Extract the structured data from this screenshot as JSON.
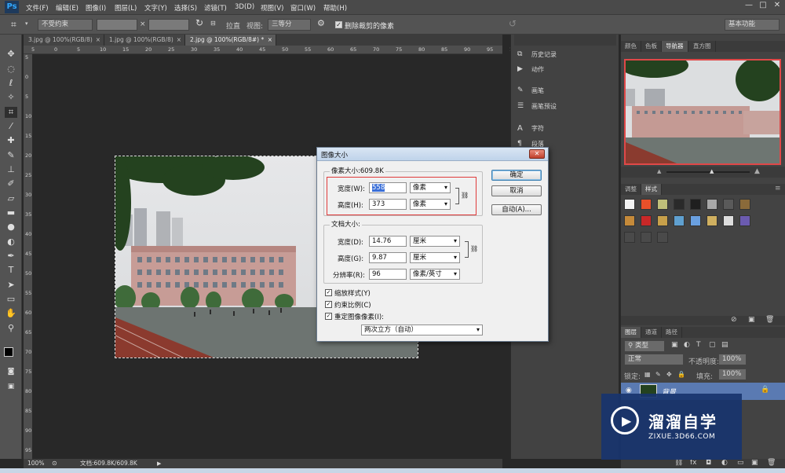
{
  "app": {
    "logo": "Ps"
  },
  "menu": [
    "文件(F)",
    "编辑(E)",
    "图像(I)",
    "图层(L)",
    "文字(Y)",
    "选择(S)",
    "滤镜(T)",
    "3D(D)",
    "视图(V)",
    "窗口(W)",
    "帮助(H)"
  ],
  "window_controls": {
    "minimize": "—",
    "maximize": "□",
    "close": "✕"
  },
  "options": {
    "ratio_select": "不受约束",
    "swap_symbol": "×",
    "straighten_label": "拉直",
    "view_label": "视图:",
    "view_select": "三等分",
    "delete_crop_label": "删除裁剪的像素",
    "delete_crop_checked": true,
    "workspace": "基本功能"
  },
  "doc_tabs": [
    {
      "label": "3.jpg @ 100%(RGB/8)",
      "close": "×"
    },
    {
      "label": "1.jpg @ 100%(RGB/8)",
      "close": "×"
    },
    {
      "label": "2.jpg @ 100%(RGB/8#) *",
      "close": "×"
    }
  ],
  "ruler_h": [
    "5",
    "0",
    "5",
    "10",
    "15",
    "20",
    "25",
    "30",
    "35",
    "40",
    "45",
    "50",
    "55",
    "60",
    "65",
    "70",
    "75",
    "80",
    "85",
    "90",
    "95",
    "100"
  ],
  "ruler_v": [
    "5",
    "0",
    "5",
    "10",
    "15",
    "20",
    "25",
    "30",
    "35",
    "40",
    "45",
    "50",
    "55",
    "60",
    "65",
    "70",
    "75",
    "80",
    "85",
    "90",
    "95"
  ],
  "status": {
    "zoom": "100%",
    "doc_info": "文档:609.8K/609.8K"
  },
  "collapsed_panels": [
    "历史记录",
    "动作",
    "画笔",
    "画笔预设",
    "字符",
    "段落"
  ],
  "right_tabs_top": [
    {
      "label": "颜色",
      "active": false
    },
    {
      "label": "色板",
      "active": false
    },
    {
      "label": "导航器",
      "active": true
    },
    {
      "label": "直方图",
      "active": false
    }
  ],
  "right_tabs_styles": [
    {
      "label": "调整",
      "active": false
    },
    {
      "label": "样式",
      "active": true
    }
  ],
  "style_swatches": [
    "#f2f2f2",
    "#e8502a",
    "#bfbf7a",
    "#2a2a2a",
    "#1f1f1f",
    "#a8a8a8",
    "#5a5a5a",
    "#8a6a3a",
    "#c58a3a",
    "#c82828",
    "#c7a04a",
    "#5fa0d0",
    "#6aa0e0",
    "#d0b060",
    "#dddddd",
    "#6b5bb0",
    "#4a4a4a",
    "#4a4a4a",
    "#4a4a4a"
  ],
  "layers": {
    "tabs": [
      {
        "label": "图层",
        "active": true
      },
      {
        "label": "通道",
        "active": false
      },
      {
        "label": "路径",
        "active": false
      }
    ],
    "filter_label": "类型",
    "blend_mode": "正常",
    "opacity_label": "不透明度:",
    "opacity_value": "100%",
    "lock_label": "锁定:",
    "fill_label": "填充:",
    "fill_value": "100%",
    "layer_name": "背景"
  },
  "dialog": {
    "title": "图像大小",
    "close": "✕",
    "pixel_dims_label": "像素大小:609.8K",
    "width_label": "宽度(W):",
    "width_value": "558",
    "width_unit": "像素",
    "height_label": "高度(H):",
    "height_value": "373",
    "height_unit": "像素",
    "doc_size_label": "文档大小:",
    "doc_width_label": "宽度(D):",
    "doc_width_value": "14.76",
    "doc_width_unit": "厘米",
    "doc_height_label": "高度(G):",
    "doc_height_value": "9.87",
    "doc_height_unit": "厘米",
    "resolution_label": "分辨率(R):",
    "resolution_value": "96",
    "resolution_unit": "像素/英寸",
    "ok": "确定",
    "cancel": "取消",
    "auto": "自动(A)...",
    "scale_styles": "缩放样式(Y)",
    "constrain": "约束比例(C)",
    "resample": "重定图像像素(I):",
    "resample_method": "两次立方（自动）",
    "link_symbol": "⛓"
  },
  "watermark": {
    "title": "溜溜自学",
    "url": "ZIXUE.3D66.COM"
  },
  "colors": {
    "highlight_box": "#e03a3a",
    "accent": "#31a8ff"
  }
}
